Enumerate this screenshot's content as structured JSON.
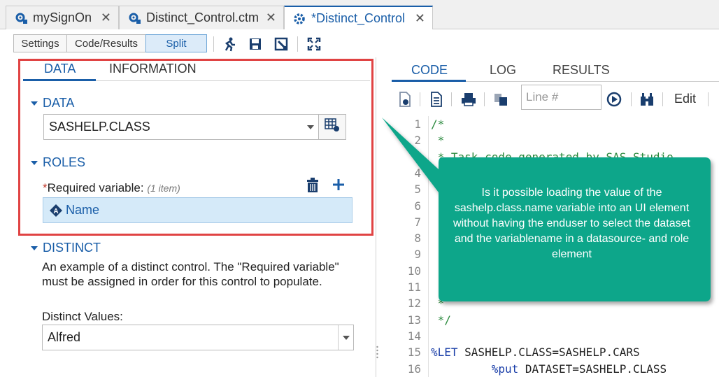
{
  "tabs": [
    {
      "label": "mySignOn",
      "icon": "gear-network-icon",
      "active": false
    },
    {
      "label": "Distinct_Control.ctm",
      "icon": "gear-network-icon",
      "active": false
    },
    {
      "label": "*Distinct_Control",
      "icon": "gear-icon",
      "active": true
    }
  ],
  "toolbar": {
    "settings_label": "Settings",
    "code_results_label": "Code/Results",
    "split_label": "Split"
  },
  "left_tabs": {
    "data": "DATA",
    "information": "INFORMATION"
  },
  "data_section": {
    "heading": "DATA",
    "dataset_value": "SASHELP.CLASS"
  },
  "roles_section": {
    "heading": "ROLES",
    "required_marker": "*",
    "required_label": "Required variable:",
    "item_hint": "(1 item)",
    "assigned_variable": "Name"
  },
  "distinct_section": {
    "heading": "DISTINCT",
    "description": "An example of a distinct control. The \"Required variable\" must be assigned in order for this control to populate.",
    "values_label": "Distinct Values:",
    "selected_value": "Alfred"
  },
  "right_tabs": {
    "code": "CODE",
    "log": "LOG",
    "results": "RESULTS"
  },
  "code_toolbar": {
    "line_placeholder": "Line #",
    "edit_label": "Edit"
  },
  "code_lines": [
    {
      "n": "1",
      "text": "/*",
      "cls": ""
    },
    {
      "n": "2",
      "text": " *",
      "cls": ""
    },
    {
      "n": "3",
      "text": " * Task code generated by SAS Studio",
      "cls": ""
    },
    {
      "n": "4",
      "text": "",
      "cls": ""
    },
    {
      "n": "5",
      "text": "",
      "cls": ""
    },
    {
      "n": "6",
      "text": "",
      "cls": ""
    },
    {
      "n": "7",
      "text": "",
      "cls": ""
    },
    {
      "n": "8",
      "text": "",
      "cls": ""
    },
    {
      "n": "9",
      "text": "",
      "cls": ""
    },
    {
      "n": "10",
      "text": "",
      "cls": ""
    },
    {
      "n": "11",
      "text": "",
      "cls": ""
    },
    {
      "n": "12",
      "text": " *",
      "cls": ""
    },
    {
      "n": "13",
      "text": " */",
      "cls": ""
    },
    {
      "n": "14",
      "text": "",
      "cls": ""
    },
    {
      "n": "15",
      "text": "%LET SASHELP.CLASS=SASHELP.CARS",
      "cls": "mixed"
    },
    {
      "n": "16",
      "text": "         %put DATASET=SASHELP.CLASS",
      "cls": "mixed2"
    }
  ],
  "callout": {
    "text": "Is it possible loading the value of the sashelp.class.name variable into an UI element without having the enduser to select the dataset and the variablename in a datasource- and role element",
    "color": "#0fa68a"
  }
}
